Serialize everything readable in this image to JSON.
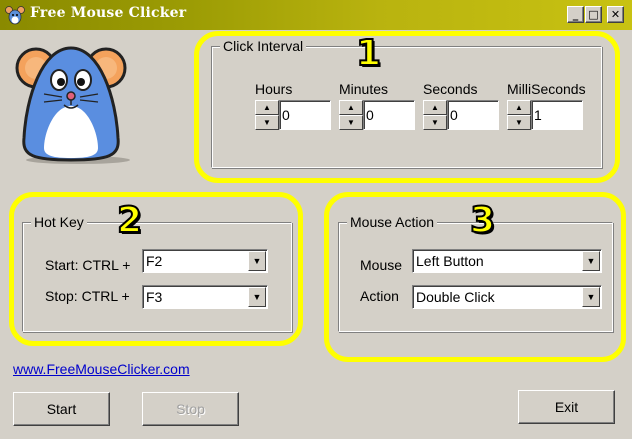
{
  "window": {
    "title": "Free Mouse Clicker",
    "title_icon": "mouse-app-icon",
    "controls": {
      "minimize": "_",
      "maximize": "□",
      "close": "✕"
    }
  },
  "logo": {
    "icon": "mouse-mascot"
  },
  "click_interval": {
    "label": "Click Interval",
    "badge": "1",
    "fields": [
      {
        "label": "Hours",
        "value": "0"
      },
      {
        "label": "Minutes",
        "value": "0"
      },
      {
        "label": "Seconds",
        "value": "0"
      },
      {
        "label": "MilliSeconds",
        "value": "1"
      }
    ]
  },
  "hot_key": {
    "label": "Hot Key",
    "badge": "2",
    "start_label": "Start: CTRL +",
    "start_value": "F2",
    "stop_label": "Stop: CTRL +",
    "stop_value": "F3"
  },
  "mouse_action": {
    "label": "Mouse Action",
    "badge": "3",
    "mouse_label": "Mouse",
    "mouse_value": "Left Button",
    "action_label": "Action",
    "action_value": "Double Click"
  },
  "footer": {
    "link": "www.FreeMouseClicker.com",
    "start_button": "Start",
    "stop_button": "Stop",
    "exit_button": "Exit"
  },
  "colors": {
    "highlight": "#ffff00",
    "face": "#d4d0c8",
    "link": "#0000cc"
  }
}
